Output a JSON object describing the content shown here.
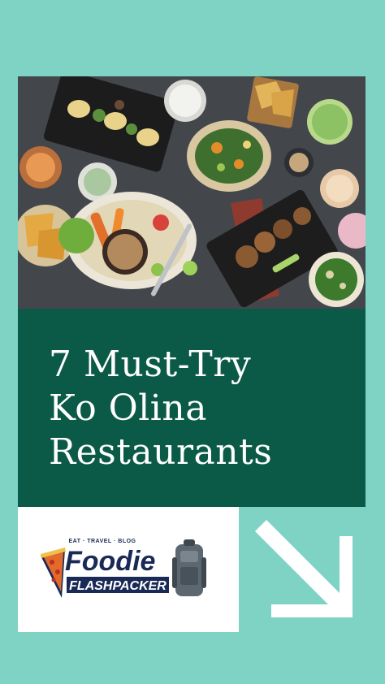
{
  "title": {
    "line1": "7 Must-Try",
    "line2": "Ko Olina",
    "line3": "Restaurants"
  },
  "logo": {
    "tagline": "EAT · TRAVEL · BLOG",
    "word1": "Foodie",
    "word2": "FLASHPACKER"
  },
  "icons": {
    "arrow": "arrow-down-right-icon",
    "pizza": "pizza-icon",
    "backpack": "backpack-icon"
  },
  "colors": {
    "background": "#7fd3c4",
    "title_block": "#0b5947",
    "text": "#ffffff",
    "logo_primary": "#1a2a57",
    "pizza": "#e36a2b"
  }
}
